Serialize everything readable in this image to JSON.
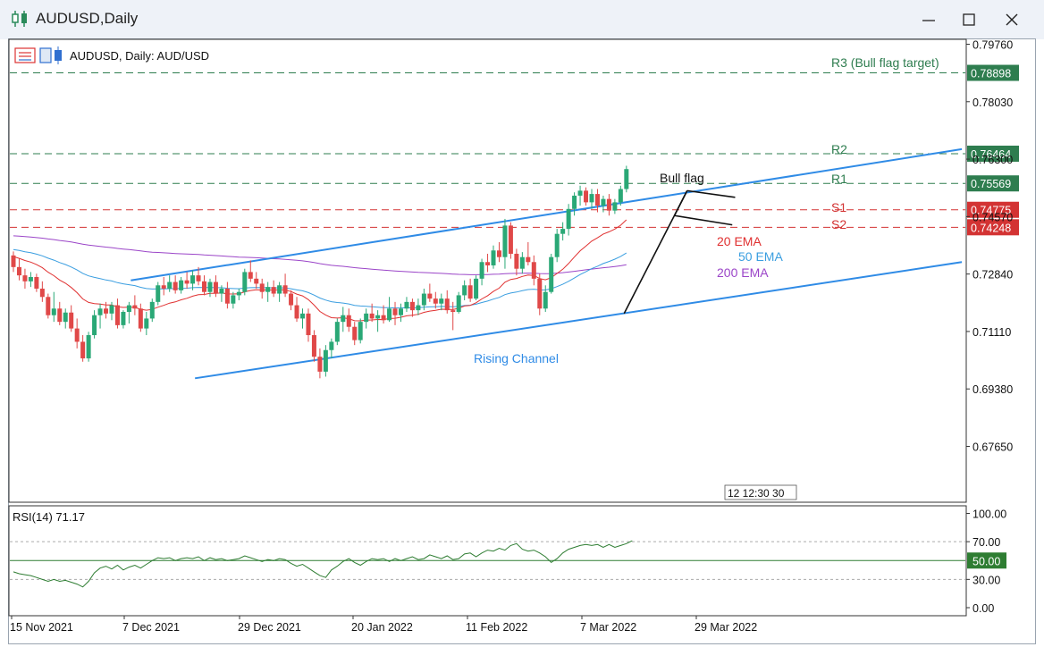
{
  "window": {
    "title": "AUDUSD,Daily",
    "minimize_glyph": "—",
    "close_glyph": "✕"
  },
  "chart_header": {
    "symbol_label": "AUDUSD, Daily:  AUD/USD"
  },
  "colors": {
    "bull_candle": "#2aa876",
    "bear_candle": "#e04848",
    "channel_line": "#2f8be6",
    "resistance_line": "#2e7d4f",
    "support_line": "#d33333",
    "ema20": "#e03030",
    "ema50": "#3a9ee0",
    "ema200": "#9b45c8",
    "rsi_line": "#2e7d32"
  },
  "icons": [
    "app-candles-icon",
    "minimize-icon",
    "maximize-icon",
    "close-icon",
    "chart-type-icon",
    "chart-properties-icon"
  ],
  "annotations": {
    "bull_flag": "Bull flag",
    "rising_channel": "Rising Channel",
    "ema20_label": "20 EMA",
    "ema50_label": "50 EMA",
    "ema200_label": "200 EMA",
    "r3_label": "R3 (Bull flag target)",
    "r2_label": "R2",
    "r1_label": "R1",
    "s1_label": "S1",
    "s2_label": "S2",
    "time_marker": "12 12:30 30"
  },
  "chart_data": [
    {
      "type": "candlestick",
      "title": "AUDUSD, Daily:  AUD/USD",
      "ylim": [
        0.6617,
        0.7976
      ],
      "y_ticks": [
        "0.79760",
        "0.78030",
        "0.76300",
        "0.74570",
        "0.72840",
        "0.71110",
        "0.69380",
        "0.67650"
      ],
      "x_ticks": [
        "15 Nov 2021",
        "7 Dec 2021",
        "29 Dec 2021",
        "20 Jan 2022",
        "11 Feb 2022",
        "7 Mar 2022",
        "29 Mar 2022"
      ],
      "price_tags": [
        {
          "label": "0.78898",
          "value": 0.78898,
          "kind": "resistance"
        },
        {
          "label": "0.76464",
          "value": 0.76464,
          "kind": "resistance"
        },
        {
          "label": "0.75569",
          "value": 0.75569,
          "kind": "resistance"
        },
        {
          "label": "0.74775",
          "value": 0.74775,
          "kind": "support"
        },
        {
          "label": "0.74248",
          "value": 0.74248,
          "kind": "support"
        }
      ],
      "levels": [
        {
          "name": "R3 (Bull flag target)",
          "value": 0.78898
        },
        {
          "name": "R2",
          "value": 0.76464
        },
        {
          "name": "R1",
          "value": 0.75569
        },
        {
          "name": "S1",
          "value": 0.74775
        },
        {
          "name": "S2",
          "value": 0.74248
        }
      ],
      "candles": [
        [
          0.734,
          0.7352,
          0.729,
          0.7305
        ],
        [
          0.7305,
          0.733,
          0.7265,
          0.728
        ],
        [
          0.728,
          0.73,
          0.724,
          0.7262
        ],
        [
          0.7262,
          0.729,
          0.7245,
          0.7275
        ],
        [
          0.7275,
          0.7285,
          0.723,
          0.724
        ],
        [
          0.724,
          0.7262,
          0.72,
          0.7215
        ],
        [
          0.7215,
          0.7225,
          0.715,
          0.716
        ],
        [
          0.716,
          0.723,
          0.714,
          0.718
        ],
        [
          0.718,
          0.72,
          0.713,
          0.714
        ],
        [
          0.714,
          0.718,
          0.712,
          0.7168
        ],
        [
          0.7168,
          0.719,
          0.711,
          0.712
        ],
        [
          0.712,
          0.715,
          0.706,
          0.708
        ],
        [
          0.708,
          0.71,
          0.702,
          0.703
        ],
        [
          0.703,
          0.711,
          0.702,
          0.71
        ],
        [
          0.71,
          0.7175,
          0.709,
          0.716
        ],
        [
          0.716,
          0.7195,
          0.712,
          0.718
        ],
        [
          0.718,
          0.72,
          0.715,
          0.7165
        ],
        [
          0.7165,
          0.72,
          0.7145,
          0.719
        ],
        [
          0.719,
          0.721,
          0.712,
          0.713
        ],
        [
          0.713,
          0.7175,
          0.712,
          0.717
        ],
        [
          0.717,
          0.72,
          0.7135,
          0.719
        ],
        [
          0.719,
          0.722,
          0.716,
          0.718
        ],
        [
          0.718,
          0.7195,
          0.711,
          0.712
        ],
        [
          0.712,
          0.717,
          0.71,
          0.715
        ],
        [
          0.715,
          0.721,
          0.714,
          0.72
        ],
        [
          0.72,
          0.726,
          0.719,
          0.725
        ],
        [
          0.725,
          0.7275,
          0.722,
          0.724
        ],
        [
          0.724,
          0.728,
          0.723,
          0.726
        ],
        [
          0.726,
          0.728,
          0.7225,
          0.7235
        ],
        [
          0.7235,
          0.7275,
          0.7225,
          0.7265
        ],
        [
          0.7265,
          0.729,
          0.724,
          0.7255
        ],
        [
          0.7255,
          0.7295,
          0.7235,
          0.728
        ],
        [
          0.728,
          0.7305,
          0.725,
          0.7262
        ],
        [
          0.7262,
          0.728,
          0.722,
          0.723
        ],
        [
          0.723,
          0.727,
          0.7215,
          0.726
        ],
        [
          0.726,
          0.728,
          0.7215,
          0.7225
        ],
        [
          0.7225,
          0.725,
          0.72,
          0.724
        ],
        [
          0.724,
          0.726,
          0.718,
          0.7195
        ],
        [
          0.7195,
          0.723,
          0.718,
          0.722
        ],
        [
          0.722,
          0.724,
          0.7205,
          0.723
        ],
        [
          0.723,
          0.73,
          0.722,
          0.729
        ],
        [
          0.729,
          0.7325,
          0.726,
          0.727
        ],
        [
          0.727,
          0.729,
          0.724,
          0.7255
        ],
        [
          0.7255,
          0.727,
          0.721,
          0.723
        ],
        [
          0.723,
          0.726,
          0.72,
          0.7245
        ],
        [
          0.7245,
          0.7265,
          0.7215,
          0.7225
        ],
        [
          0.7225,
          0.726,
          0.72,
          0.725
        ],
        [
          0.725,
          0.7285,
          0.7215,
          0.7225
        ],
        [
          0.7225,
          0.7235,
          0.7175,
          0.719
        ],
        [
          0.719,
          0.7215,
          0.714,
          0.715
        ],
        [
          0.715,
          0.718,
          0.712,
          0.7165
        ],
        [
          0.7165,
          0.718,
          0.708,
          0.71
        ],
        [
          0.71,
          0.7115,
          0.702,
          0.7035
        ],
        [
          0.7035,
          0.706,
          0.697,
          0.699
        ],
        [
          0.699,
          0.707,
          0.6975,
          0.7055
        ],
        [
          0.7055,
          0.709,
          0.703,
          0.708
        ],
        [
          0.708,
          0.715,
          0.707,
          0.714
        ],
        [
          0.714,
          0.7185,
          0.711,
          0.716
        ],
        [
          0.716,
          0.718,
          0.711,
          0.7125
        ],
        [
          0.7125,
          0.714,
          0.707,
          0.7085
        ],
        [
          0.7085,
          0.715,
          0.7075,
          0.714
        ],
        [
          0.714,
          0.718,
          0.712,
          0.7165
        ],
        [
          0.7165,
          0.7195,
          0.714,
          0.715
        ],
        [
          0.715,
          0.7175,
          0.711,
          0.716
        ],
        [
          0.716,
          0.719,
          0.7135,
          0.7145
        ],
        [
          0.7145,
          0.7215,
          0.714,
          0.718
        ],
        [
          0.718,
          0.72,
          0.713,
          0.716
        ],
        [
          0.716,
          0.7195,
          0.714,
          0.718
        ],
        [
          0.718,
          0.7215,
          0.717,
          0.72
        ],
        [
          0.72,
          0.721,
          0.7155,
          0.7175
        ],
        [
          0.7175,
          0.721,
          0.716,
          0.719
        ],
        [
          0.719,
          0.724,
          0.7175,
          0.7225
        ],
        [
          0.7225,
          0.7255,
          0.72,
          0.721
        ],
        [
          0.721,
          0.723,
          0.718,
          0.7195
        ],
        [
          0.7195,
          0.7225,
          0.7175,
          0.721
        ],
        [
          0.721,
          0.7235,
          0.7165,
          0.7175
        ],
        [
          0.7175,
          0.72,
          0.7115,
          0.717
        ],
        [
          0.717,
          0.723,
          0.7165,
          0.722
        ],
        [
          0.722,
          0.7265,
          0.7205,
          0.725
        ],
        [
          0.725,
          0.727,
          0.72,
          0.721
        ],
        [
          0.721,
          0.728,
          0.7205,
          0.727
        ],
        [
          0.727,
          0.733,
          0.725,
          0.732
        ],
        [
          0.732,
          0.7345,
          0.729,
          0.731
        ],
        [
          0.731,
          0.737,
          0.73,
          0.7355
        ],
        [
          0.7355,
          0.738,
          0.732,
          0.7335
        ],
        [
          0.7335,
          0.745,
          0.73,
          0.743
        ],
        [
          0.743,
          0.744,
          0.733,
          0.7345
        ],
        [
          0.7345,
          0.736,
          0.728,
          0.73
        ],
        [
          0.73,
          0.735,
          0.7285,
          0.7335
        ],
        [
          0.7335,
          0.738,
          0.731,
          0.732
        ],
        [
          0.732,
          0.734,
          0.725,
          0.727
        ],
        [
          0.727,
          0.7285,
          0.716,
          0.718
        ],
        [
          0.718,
          0.725,
          0.717,
          0.723
        ],
        [
          0.723,
          0.7345,
          0.7225,
          0.7335
        ],
        [
          0.7335,
          0.742,
          0.732,
          0.7405
        ],
        [
          0.7405,
          0.744,
          0.7385,
          0.742
        ],
        [
          0.742,
          0.7495,
          0.74,
          0.748
        ],
        [
          0.748,
          0.753,
          0.746,
          0.752
        ],
        [
          0.752,
          0.755,
          0.749,
          0.7535
        ],
        [
          0.7535,
          0.7545,
          0.749,
          0.75
        ],
        [
          0.75,
          0.754,
          0.748,
          0.7525
        ],
        [
          0.7525,
          0.754,
          0.747,
          0.749
        ],
        [
          0.749,
          0.752,
          0.747,
          0.751
        ],
        [
          0.751,
          0.7525,
          0.746,
          0.7475
        ],
        [
          0.7475,
          0.751,
          0.7465,
          0.75
        ],
        [
          0.75,
          0.755,
          0.749,
          0.754
        ],
        [
          0.754,
          0.761,
          0.753,
          0.76
        ]
      ],
      "candle_columns": [
        "open",
        "high",
        "low",
        "close"
      ]
    },
    {
      "type": "line",
      "title": "RSI(14) 71.17",
      "ylim": [
        0,
        100
      ],
      "y_ticks": [
        "100.00",
        "70.00",
        "50.00",
        "30.00",
        "0.00"
      ],
      "levels": [
        70,
        50,
        30
      ],
      "series": [
        {
          "name": "RSI(14)",
          "values": [
            38,
            36,
            35,
            34,
            32,
            30,
            28,
            30,
            28,
            29,
            27,
            25,
            22,
            28,
            37,
            42,
            44,
            41,
            45,
            40,
            43,
            45,
            42,
            46,
            50,
            53,
            52,
            53,
            50,
            52,
            53,
            52,
            54,
            50,
            53,
            51,
            52,
            50,
            51,
            52,
            55,
            53,
            51,
            49,
            51,
            50,
            52,
            51,
            47,
            44,
            46,
            42,
            38,
            34,
            32,
            40,
            44,
            49,
            52,
            48,
            45,
            49,
            52,
            51,
            52,
            49,
            52,
            50,
            52,
            54,
            51,
            52,
            56,
            54,
            52,
            55,
            51,
            52,
            57,
            58,
            54,
            58,
            61,
            60,
            63,
            61,
            66,
            68,
            62,
            60,
            61,
            58,
            54,
            48,
            52,
            58,
            62,
            64,
            66,
            67,
            66,
            67,
            64,
            67,
            64,
            66,
            68,
            71
          ]
        }
      ]
    }
  ]
}
